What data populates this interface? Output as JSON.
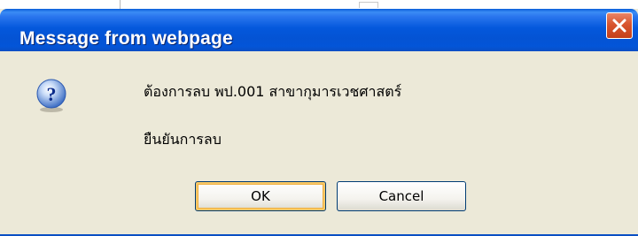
{
  "dialog": {
    "title": "Message from webpage",
    "message_line1": "ต้องการลบ  พป.001 สาขากุมารเวชศาสตร์",
    "message_line2": "ยืนยันการลบ",
    "ok_label": "OK",
    "cancel_label": "Cancel",
    "icon": "question-icon"
  },
  "colors": {
    "titlebar": "#0458dc",
    "dialog_bg": "#ece9d8",
    "close_button": "#d8542e"
  }
}
